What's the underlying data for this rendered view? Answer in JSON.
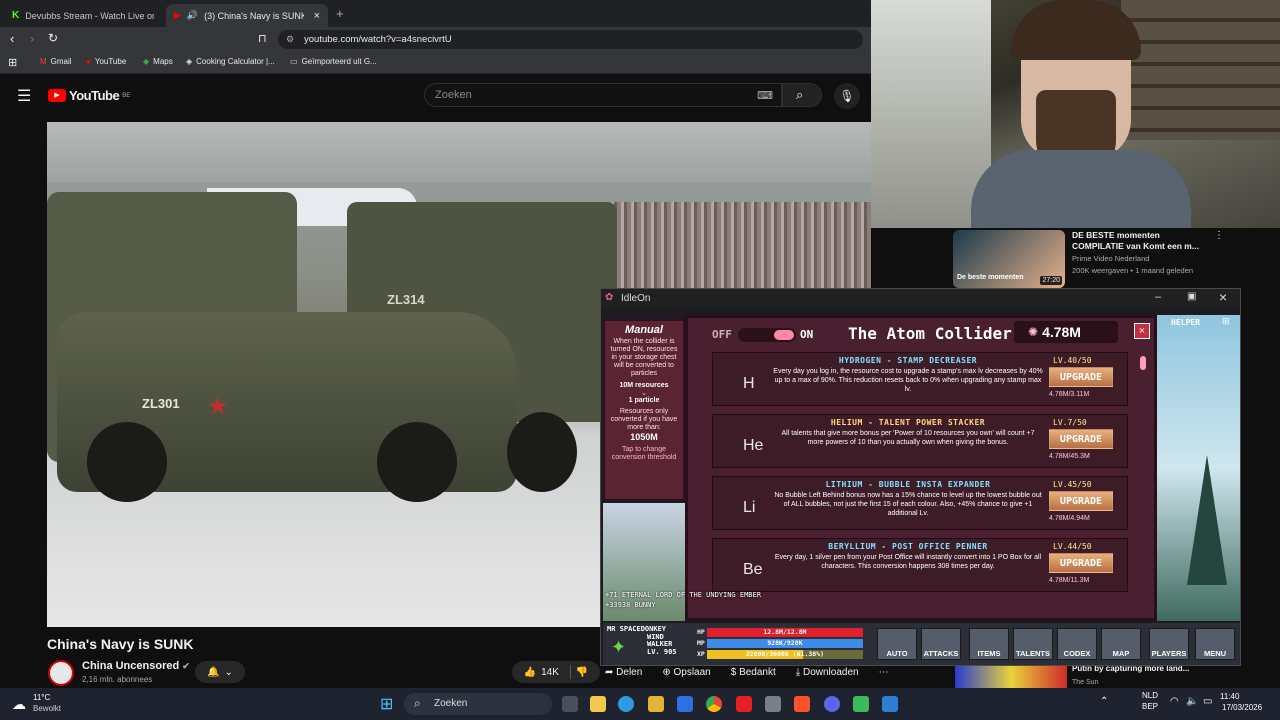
{
  "browser": {
    "tabs": [
      {
        "title": "Devubbs Stream - Watch Live on"
      },
      {
        "title": "(3) China's Navy is SUNK - Yo"
      }
    ],
    "url": "youtube.com/watch?v=a4snecivrtU",
    "bookmarks": [
      "Gmail",
      "YouTube",
      "Maps",
      "Cooking Calculator |...",
      "Geïmporteerd uit G..."
    ]
  },
  "youtube": {
    "logo": "YouTube",
    "country": "BE",
    "search_placeholder": "Zoeken",
    "video_title": "China's Navy is SUNK",
    "channel": "China Uncensored",
    "subscribers": "2,16 mln. abonnees",
    "likes": "14K",
    "actions": [
      "Delen",
      "Opslaan",
      "Bedankt",
      "Downloaden"
    ],
    "video_overlay": {
      "vehicle1": "ZL301",
      "vehicle2": "ZL314"
    },
    "recommended": {
      "title": "DE BESTE momenten COMPILATIE van Komt een m...",
      "channel": "Prime Video Nederland",
      "meta": "200K weergaven • 1 maand geleden",
      "duration": "27:20",
      "thumb_text": "De beste momenten"
    },
    "partial_recommend": {
      "title": "Putin by capturing more land...",
      "channel": "The Sun"
    }
  },
  "idleon": {
    "window_title": "IdleOn",
    "manual": {
      "title": "Manual",
      "text": "When the collider is turned ON, resources in your storage chest will be converted to particles",
      "rate1": "10M resources",
      "rate2": "1 particle",
      "text2": "Resources only converted if you have more than:",
      "threshold": "1050M",
      "tap": "Tap to change conversion threshold"
    },
    "collider": {
      "off": "OFF",
      "on": "ON",
      "title": "The Atom Collider",
      "particles": "4.78M",
      "atoms": [
        {
          "title": "HYDROGEN - STAMP DECREASER",
          "level": "LV.40/50",
          "desc": "Every day you log in, the resource cost to upgrade a stamp's max lv decreases by 40% up to a max of 90%. This reduction resets back to 0% when upgrading any stamp max lv.",
          "cost": "4.78M/3.11M",
          "sym": "H",
          "btn": "UPGRADE"
        },
        {
          "title": "HELIUM - TALENT POWER STACKER",
          "level": "LV.7/50",
          "desc": "All talents that give more bonus per 'Power of 10 resources you own' will count +7 more powers of 10 than you actually own when giving the bonus.",
          "cost": "4.78M/45.3M",
          "sym": "He",
          "btn": "UPGRADE"
        },
        {
          "title": "LITHIUM - BUBBLE INSTA EXPANDER",
          "level": "LV.45/50",
          "desc": "No Bubble Left Behind bonus now has a 15% chance to level up the lowest bubble out of ALL bubbles, not just the first 15 of each colour. Also, +45% chance to give +1 additional Lv.",
          "cost": "4.78M/4.94M",
          "sym": "Li",
          "btn": "UPGRADE"
        },
        {
          "title": "BERYLLIUM - POST OFFICE PENNER",
          "level": "LV.44/50",
          "desc": "Every day, 1 silver pen from your Post Office will instantly convert into 1 PO Box for all characters. This conversion happens 308 times per day.",
          "cost": "4.78M/11.3M",
          "sym": "Be",
          "btn": "UPGRADE"
        }
      ]
    },
    "helper": "HELPER",
    "chat": "+71 ETERNAL LORD OF THE UNDYING EMBER",
    "chat2": "+33938 BUNNY",
    "player": {
      "name": "MR SPACEDONKEY",
      "class": "WIND WALKER",
      "level": "LV. 905",
      "hp": "12.8M/12.8M",
      "mp": "928K/928K",
      "xp": "22000/36000 (61.38%)"
    },
    "hud": [
      "AUTO",
      "ATTACKS",
      "ITEMS",
      "TALENTS",
      "CODEX",
      "MAP",
      "PLAYERS",
      "MENU"
    ]
  },
  "taskbar": {
    "weather_temp": "11°C",
    "weather_desc": "Bewolkt",
    "search": "Zoeken",
    "lang1": "NLD",
    "lang2": "BEP",
    "time": "11:40",
    "date": "17/03/2026"
  }
}
